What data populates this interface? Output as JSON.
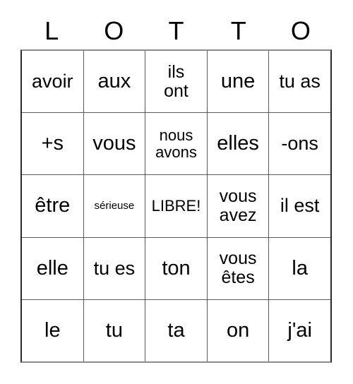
{
  "card": {
    "title": "LOTTO",
    "header_letters": [
      "L",
      "O",
      "T",
      "T",
      "O"
    ],
    "colors": {
      "text": "#000000",
      "grid_line": "#5a5a5a",
      "outer_border": "#2b2b2b",
      "background": "#ffffff"
    },
    "rows": [
      [
        {
          "text": "avoir",
          "size": "lg"
        },
        {
          "text": "aux",
          "size": "xl"
        },
        {
          "text": "ils\nont",
          "size": "md"
        },
        {
          "text": "une",
          "size": "xl"
        },
        {
          "text": "tu as",
          "size": "lg"
        }
      ],
      [
        {
          "text": "+s",
          "size": "xl"
        },
        {
          "text": "vous",
          "size": "xl"
        },
        {
          "text": "nous\navons",
          "size": "sm"
        },
        {
          "text": "elles",
          "size": "xl"
        },
        {
          "text": "-ons",
          "size": "lg"
        }
      ],
      [
        {
          "text": "être",
          "size": "xl"
        },
        {
          "text": "sérieuse",
          "size": "xs"
        },
        {
          "text": "LIBRE!",
          "size": "free"
        },
        {
          "text": "vous\navez",
          "size": "md"
        },
        {
          "text": "il est",
          "size": "lg"
        }
      ],
      [
        {
          "text": "elle",
          "size": "xl"
        },
        {
          "text": "tu es",
          "size": "lg"
        },
        {
          "text": "ton",
          "size": "xl"
        },
        {
          "text": "vous\nêtes",
          "size": "md"
        },
        {
          "text": "la",
          "size": "xl"
        }
      ],
      [
        {
          "text": "le",
          "size": "xl"
        },
        {
          "text": "tu",
          "size": "xl"
        },
        {
          "text": "ta",
          "size": "xl"
        },
        {
          "text": "on",
          "size": "xl"
        },
        {
          "text": "j'ai",
          "size": "xl"
        }
      ]
    ]
  }
}
